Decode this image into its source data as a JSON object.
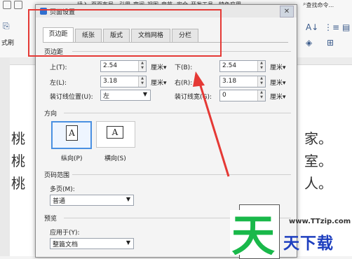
{
  "ribbon": {
    "menu": [
      "插入",
      "页面布局",
      "引用",
      "审阅",
      "视图",
      "章节",
      "安全",
      "开发工具",
      "特色应用"
    ],
    "search_label": "查找命令...",
    "left_label": "式刷"
  },
  "document": {
    "left_chars": [
      "桃",
      "桃",
      "桃"
    ],
    "right_chars": [
      "家。",
      "室。",
      "人。"
    ]
  },
  "dialog": {
    "title": "页面设置",
    "close_glyph": "✕",
    "tabs": [
      "页边距",
      "纸张",
      "版式",
      "文档网格",
      "分栏"
    ],
    "active_tab": "页边距",
    "margins": {
      "section_label": "页边距",
      "top_label": "上(T):",
      "top_value": "2.54",
      "bottom_label": "下(B):",
      "bottom_value": "2.54",
      "left_label": "左(L):",
      "left_value": "3.18",
      "right_label": "右(R):",
      "right_value": "3.18",
      "unit": "厘米",
      "gutter_pos_label": "装订线位置(U):",
      "gutter_pos_value": "左",
      "gutter_width_label": "装订线宽(G):",
      "gutter_width_value": "0"
    },
    "orientation": {
      "section_label": "方向",
      "portrait_label": "纵向(P)",
      "landscape_label": "横向(S)",
      "glyph": "A",
      "selected": "portrait"
    },
    "pages": {
      "section_label": "页码范围",
      "multi_label": "多页(M):",
      "multi_value": "普通"
    },
    "preview": {
      "section_label": "预览",
      "apply_label": "应用于(Y):",
      "apply_value": "整篇文档"
    }
  },
  "annotation": {
    "color": "#e53935"
  },
  "watermark": {
    "site": "www.TTzip.com",
    "big_char": "天",
    "brand": "天下载"
  }
}
